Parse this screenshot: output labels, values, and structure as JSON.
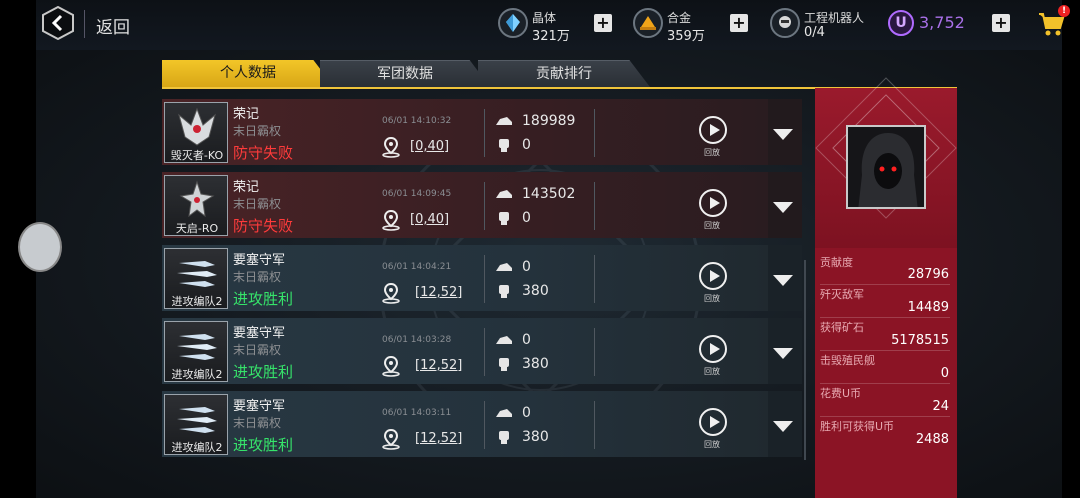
{
  "header": {
    "back_label": "返回",
    "resources": [
      {
        "icon": "crystal-icon",
        "name": "晶体",
        "value": "321万"
      },
      {
        "icon": "alloy-icon",
        "name": "合金",
        "value": "359万"
      },
      {
        "icon": "robot-icon",
        "name": "工程机器人",
        "value": "0/4"
      }
    ],
    "ucoin_symbol": "U",
    "ucoin_value": "3,752",
    "cart_badge": "!",
    "plus_label": "+"
  },
  "tabs": [
    {
      "label": "个人数据",
      "active": true
    },
    {
      "label": "军团数据",
      "active": false
    },
    {
      "label": "贡献排行",
      "active": false
    }
  ],
  "records": [
    {
      "ship": "毁灭者-KO",
      "name": "荣记",
      "sub": "末日霸权",
      "result": "防守失败",
      "outcome": "defeat",
      "time": "06/01 14:10:32",
      "coord": "[0,40]",
      "stat1": "189989",
      "stat2": "0",
      "replay": "回放"
    },
    {
      "ship": "天启-RO",
      "name": "荣记",
      "sub": "末日霸权",
      "result": "防守失败",
      "outcome": "defeat",
      "time": "06/01 14:09:45",
      "coord": "[0,40]",
      "stat1": "143502",
      "stat2": "0",
      "replay": "回放"
    },
    {
      "ship": "进攻编队2",
      "name": "要塞守军",
      "sub": "末日霸权",
      "result": "进攻胜利",
      "outcome": "victory",
      "time": "06/01 14:04:21",
      "coord": "[12,52]",
      "stat1": "0",
      "stat2": "380",
      "replay": "回放"
    },
    {
      "ship": "进攻编队2",
      "name": "要塞守军",
      "sub": "末日霸权",
      "result": "进攻胜利",
      "outcome": "victory",
      "time": "06/01 14:03:28",
      "coord": "[12,52]",
      "stat1": "0",
      "stat2": "380",
      "replay": "回放"
    },
    {
      "ship": "进攻编队2",
      "name": "要塞守军",
      "sub": "末日霸权",
      "result": "进攻胜利",
      "outcome": "victory",
      "time": "06/01 14:03:11",
      "coord": "[12,52]",
      "stat1": "0",
      "stat2": "380",
      "replay": "回放"
    }
  ],
  "stats_panel": [
    {
      "label": "贡献度",
      "value": "28796"
    },
    {
      "label": "歼灭敌军",
      "value": "14489"
    },
    {
      "label": "获得矿石",
      "value": "5178515"
    },
    {
      "label": "击毁殖民舰",
      "value": "0"
    },
    {
      "label": "花费U币",
      "value": "24"
    },
    {
      "label": "胜利可获得U币",
      "value": "2488"
    }
  ],
  "colors": {
    "tab_active": "#f3c628",
    "defeat_text": "#ff3b3b",
    "victory_text": "#36e36a",
    "panel_red": "#8b1425",
    "ucoin_purple": "#a970e8"
  }
}
